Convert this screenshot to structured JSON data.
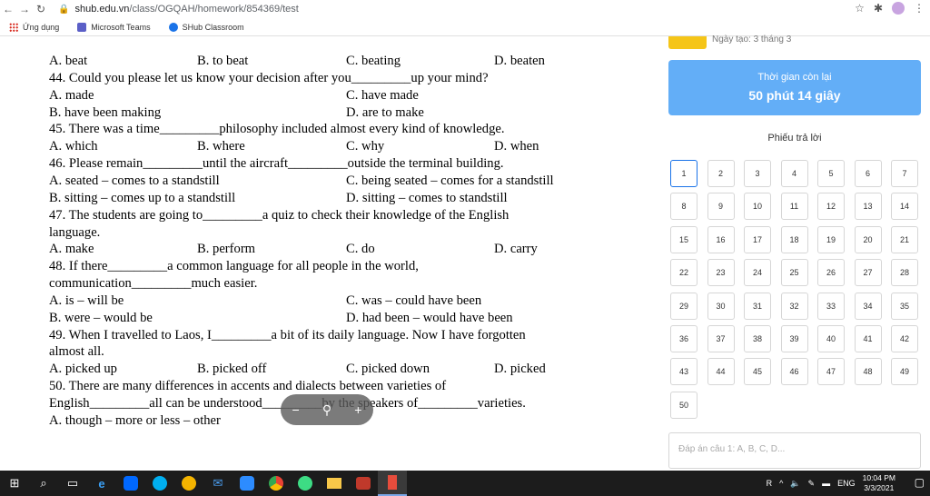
{
  "browser": {
    "url_host": "shub.edu.vn",
    "url_path": "/class/OGQAH/homework/854369/test",
    "bookmarks": [
      {
        "label": "Ứng dụng",
        "icon": "apps-grid-icon"
      },
      {
        "label": "Microsoft Teams",
        "icon": "teams-icon"
      },
      {
        "label": "SHub Classroom",
        "icon": "shub-icon"
      }
    ]
  },
  "document": {
    "lines": [
      {
        "text": "A. beat",
        "cols": [
          "B. to beat",
          "C. beating",
          "D. beaten"
        ]
      },
      {
        "text": "44. Could you please let us know your decision after you_________up your mind?"
      },
      {
        "text": "A. made",
        "cols": [
          "",
          "C. have made",
          ""
        ]
      },
      {
        "text": "B. have been making",
        "cols": [
          "",
          "D. are to make",
          ""
        ]
      },
      {
        "text": "45. There was a time_________philosophy included almost every kind of knowledge."
      },
      {
        "text": "A. which",
        "cols": [
          "B. where",
          "C. why",
          "D. when"
        ]
      },
      {
        "text": "46. Please remain_________until the aircraft_________outside the terminal building."
      },
      {
        "text": "A. seated – comes to a standstill",
        "cols": [
          "",
          "C. being seated – comes for a standstill",
          ""
        ]
      },
      {
        "text": "B. sitting – comes up to a standstill",
        "cols": [
          "",
          "D.  sitting  –  comes  to  standstill",
          ""
        ]
      },
      {
        "text": "47. The students are going to_________a quiz to check their knowledge of the English"
      },
      {
        "text": "language."
      },
      {
        "text": "A. make",
        "cols": [
          "B. perform",
          "C. do",
          "D. carry"
        ]
      },
      {
        "text": "48.  If  there_________a  common  language  for  all  people  in  the  world,"
      },
      {
        "text": "communication_________much easier."
      },
      {
        "text": "A. is – will be",
        "cols": [
          "",
          "C. was – could have been",
          ""
        ]
      },
      {
        "text": "B. were – would be",
        "cols": [
          "",
          "D. had been – would have been",
          ""
        ]
      },
      {
        "text": "49. When I travelled to Laos, I_________a bit of its daily language. Now I have forgotten"
      },
      {
        "text": "almost all."
      },
      {
        "text": "A. picked up",
        "cols": [
          "B. picked off",
          "C. picked down",
          "D. picked"
        ]
      },
      {
        "text": "50.  There  are  many  differences  in  accents  and  dialects  between  varieties  of"
      },
      {
        "text": "English_________all can be understood_________by the speakers of_________varieties."
      },
      {
        "text": "A. though – more or less – other"
      }
    ]
  },
  "zoom": {
    "minus": "−",
    "plus": "+"
  },
  "panel": {
    "date_text": "Ngày tạo: 3 tháng 3",
    "timer_label": "Thời gian còn lại",
    "timer_value": "50 phút 14 giây",
    "sheet_title": "Phiếu trả lời",
    "answer_placeholder": "Đáp án câu 1: A, B, C, D...",
    "questions": [
      1,
      2,
      3,
      4,
      5,
      6,
      7,
      8,
      9,
      10,
      11,
      12,
      13,
      14,
      15,
      16,
      17,
      18,
      19,
      20,
      21,
      22,
      23,
      24,
      25,
      26,
      27,
      28,
      29,
      30,
      31,
      32,
      33,
      34,
      35,
      36,
      37,
      38,
      39,
      40,
      41,
      42,
      43,
      44,
      45,
      46,
      47,
      48,
      49,
      50
    ],
    "active_question": 1
  },
  "taskbar": {
    "ime": "R",
    "lang": "ENG",
    "time": "10:04 PM",
    "date": "3/3/2021"
  }
}
